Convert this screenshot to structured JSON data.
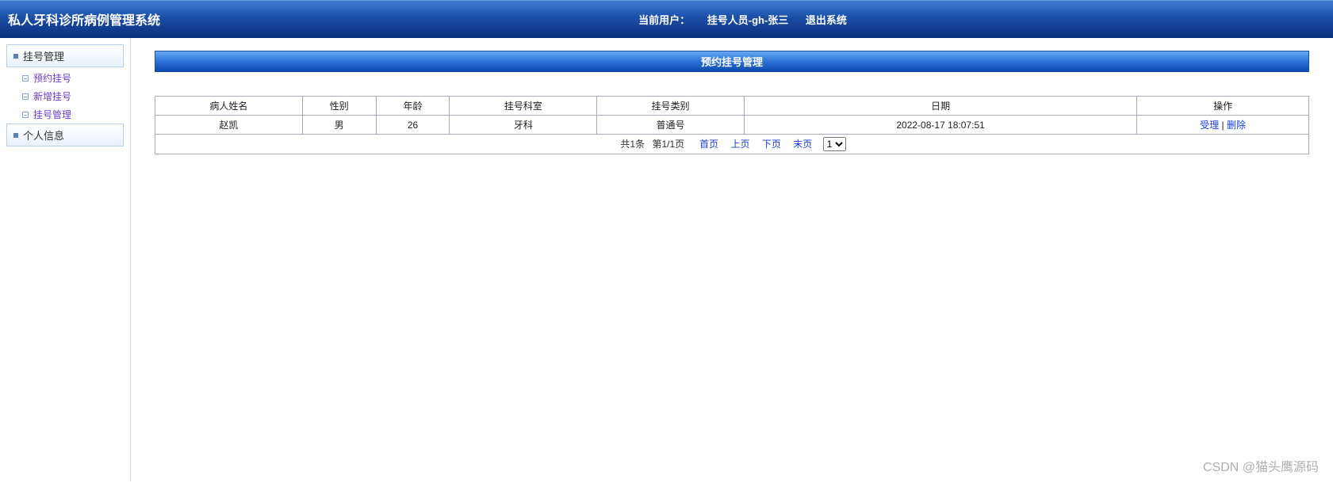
{
  "header": {
    "title": "私人牙科诊所病例管理系统",
    "current_user_label": "当前用户：",
    "user_info": "挂号人员-gh-张三",
    "logout": "退出系统"
  },
  "sidebar": {
    "groups": [
      {
        "label": "挂号管理",
        "items": [
          {
            "label": "预约挂号"
          },
          {
            "label": "新增挂号"
          },
          {
            "label": "挂号管理"
          }
        ]
      },
      {
        "label": "个人信息",
        "items": []
      }
    ]
  },
  "main": {
    "panel_title": "预约挂号管理",
    "table": {
      "headers": [
        "病人姓名",
        "性别",
        "年龄",
        "挂号科室",
        "挂号类别",
        "日期",
        "操作"
      ],
      "rows": [
        {
          "name": "赵凯",
          "gender": "男",
          "age": "26",
          "dept": "牙科",
          "type": "普通号",
          "date": "2022-08-17 18:07:51",
          "actions": [
            "受理",
            "删除"
          ]
        }
      ]
    },
    "pager": {
      "total": "共1条",
      "page": "第1/1页",
      "first": "首页",
      "prev": "上页",
      "next": "下页",
      "last": "末页",
      "select": "1"
    }
  },
  "watermark": "CSDN @猫头鹰源码"
}
